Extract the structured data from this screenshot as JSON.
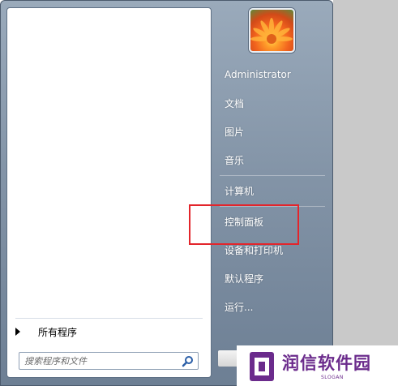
{
  "start_menu": {
    "user": {
      "name": "Administrator"
    },
    "right_items": [
      {
        "label": "Administrator"
      },
      {
        "label": "文档"
      },
      {
        "label": "图片"
      },
      {
        "label": "音乐"
      },
      {
        "label": "计算机"
      },
      {
        "label": "控制面板"
      },
      {
        "label": "设备和打印机"
      },
      {
        "label": "默认程序"
      },
      {
        "label": "运行..."
      }
    ],
    "all_programs_label": "所有程序",
    "search": {
      "placeholder": "搜索程序和文件",
      "value": ""
    }
  },
  "watermark": {
    "title": "润信软件园",
    "slogan": "SLOGAN"
  },
  "colors": {
    "highlight": "#e3252b",
    "watermark": "#6b2b8c"
  }
}
